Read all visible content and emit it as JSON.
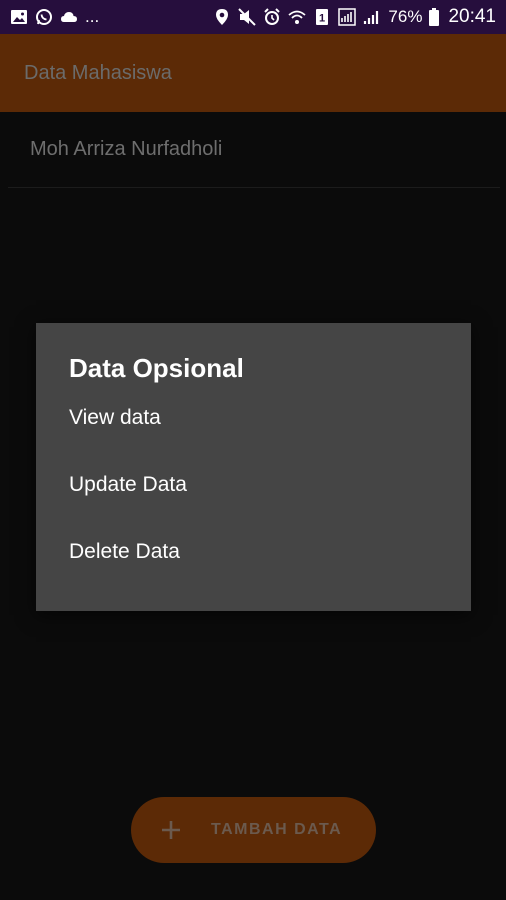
{
  "status_bar": {
    "ellipsis": "...",
    "battery_percent": "76%",
    "time": "20:41",
    "sim_badge": "1",
    "icons": [
      "gallery-icon",
      "whatsapp-icon",
      "cloud-icon",
      "location-icon",
      "mute-icon",
      "alarm-icon",
      "wifi-icon",
      "sim-icon",
      "signal-icon",
      "battery-icon"
    ]
  },
  "app_bar": {
    "title": "Data Mahasiswa",
    "color": "#5c2a06"
  },
  "list": {
    "items": [
      {
        "label": "Moh Arriza Nurfadholi"
      }
    ]
  },
  "dialog": {
    "title": "Data Opsional",
    "options": [
      {
        "label": "View data"
      },
      {
        "label": "Update Data"
      },
      {
        "label": "Delete Data"
      }
    ],
    "background": "#454545"
  },
  "fab": {
    "icon": "plus-icon",
    "label": "TAMBAH DATA"
  }
}
